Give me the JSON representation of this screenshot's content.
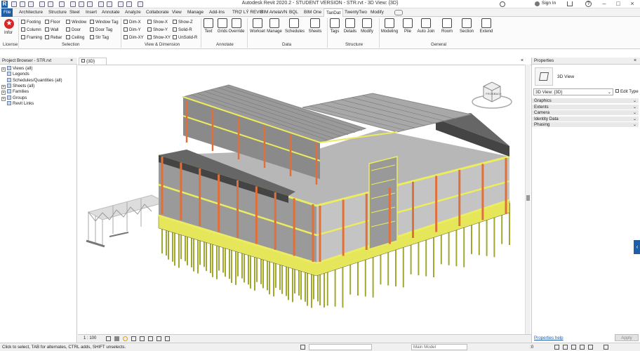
{
  "titlebar": {
    "title": "Autodesk Revit 2020.2 - STUDENT VERSION - STR.rvt - 3D View: {3D}",
    "sign_in": "Sign In"
  },
  "tabs": [
    "File",
    "Architecture",
    "Structure",
    "Steel",
    "Insert",
    "Annotate",
    "Analyze",
    "Collaborate",
    "View",
    "Manage",
    "Add-Ins",
    "TRỢ LÝ REVIT",
    "BIM ArtelaVN",
    "BQL",
    "BIM One",
    "TanDat",
    "TwentyTwo",
    "Modify"
  ],
  "active_tab": "TanDat",
  "ribbon": {
    "infor_label": "Infor",
    "selection_tools": [
      [
        "Footing",
        "Floor",
        "Window",
        "Window Tag"
      ],
      [
        "Column",
        "Wall",
        "Door",
        "Door Tag"
      ],
      [
        "Framing",
        "Rebar",
        "Ceiling",
        "Str Tag"
      ]
    ],
    "dim_tools": [
      [
        "Dim-X",
        "Show-X",
        "Show-Z"
      ],
      [
        "Dim-Y",
        "Show-Y",
        "Solid-R"
      ],
      [
        "Dim-XY",
        "Show-XY",
        "UnSolid-R"
      ]
    ],
    "annotate_tools": [
      "Text",
      "Grids",
      "Override"
    ],
    "data_tools": [
      "Workset",
      "Manage",
      "Schedules",
      "Sheets"
    ],
    "structure_tools": [
      "Tags",
      "Details",
      "Modify"
    ],
    "general_tools": [
      "Modeling",
      "Pile",
      "Auto Join",
      "Room",
      "Section",
      "Extend"
    ],
    "panel_labels": [
      "License",
      "Selection",
      "View & Dimension",
      "Annotate",
      "Data",
      "Structure",
      "General"
    ]
  },
  "project_browser": {
    "title": "Project Browser - STR.rvt",
    "items": [
      {
        "label": "Views (all)",
        "expand": "+",
        "icon": "views-icon"
      },
      {
        "label": "Legends",
        "expand": "",
        "icon": "legend-icon"
      },
      {
        "label": "Schedules/Quantities (all)",
        "expand": "",
        "icon": "schedule-icon"
      },
      {
        "label": "Sheets (all)",
        "expand": "+",
        "icon": "sheet-icon"
      },
      {
        "label": "Families",
        "expand": "+",
        "icon": "family-icon"
      },
      {
        "label": "Groups",
        "expand": "+",
        "icon": "group-icon"
      },
      {
        "label": "Revit Links",
        "expand": "",
        "icon": "link-icon"
      }
    ]
  },
  "view": {
    "tab_label": "{3D}",
    "scale": "1 : 100"
  },
  "properties": {
    "title": "Properties",
    "type_name": "3D View",
    "selector_value": "3D View: {3D}",
    "edit_type": "Edit Type",
    "groups": [
      "Graphics",
      "Extents",
      "Camera",
      "Identity Data",
      "Phasing"
    ],
    "help_link": "Properties help",
    "apply": "Apply"
  },
  "status": {
    "message": "Click to select, TAB for alternates, CTRL adds, SHIFT unselects.",
    "model": "Main Model",
    "coord": ":0"
  },
  "colors": {
    "file_tab": "#1e5fa8",
    "column": "#e0703a",
    "beam": "#ecec60",
    "slab": "#8c8c8c",
    "pile": "#a0a830"
  }
}
